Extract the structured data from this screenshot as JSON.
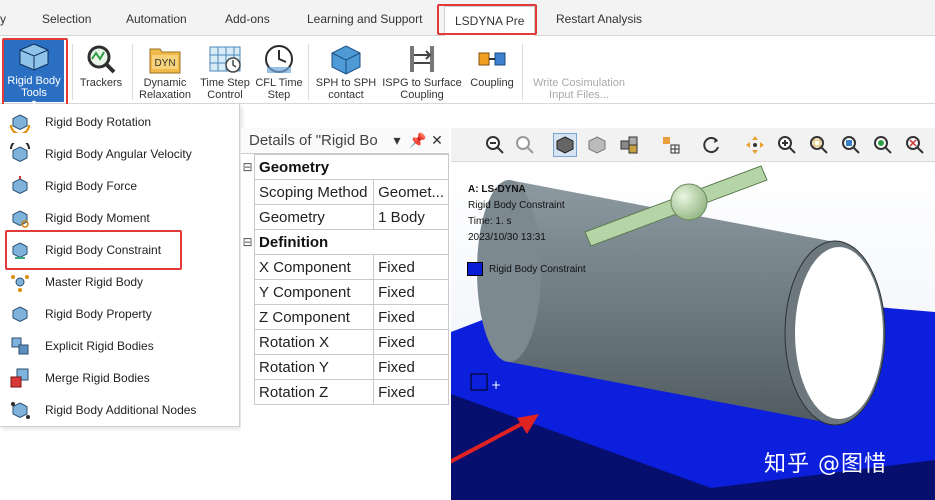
{
  "tabs": [
    {
      "label": "y"
    },
    {
      "label": "Selection"
    },
    {
      "label": "Automation"
    },
    {
      "label": "Add-ons"
    },
    {
      "label": "Learning and Support"
    },
    {
      "label": "LSDYNA Pre"
    },
    {
      "label": "Restart Analysis"
    }
  ],
  "ribbon": {
    "rigid_body_tools": "Rigid Body Tools",
    "trackers": "Trackers",
    "dynamic_relaxation": "Dynamic Relaxation",
    "dyn_icon_text": "DYN",
    "time_step_control": "Time Step Control",
    "cfl_time_step": "CFL Time Step",
    "sph_to_sph": "SPH to SPH contact",
    "ispg_to_surface": "ISPG to Surface Coupling",
    "coupling": "Coupling",
    "write_cosimulation": "Write Cosimulation Input Files..."
  },
  "menu": {
    "items": [
      {
        "label": "Rigid Body Rotation"
      },
      {
        "label": "Rigid Body Angular Velocity"
      },
      {
        "label": "Rigid Body Force"
      },
      {
        "label": "Rigid Body Moment"
      },
      {
        "label": "Rigid Body Constraint"
      },
      {
        "label": "Master Rigid Body"
      },
      {
        "label": "Rigid Body Property"
      },
      {
        "label": "Explicit Rigid Bodies"
      },
      {
        "label": "Merge Rigid Bodies"
      },
      {
        "label": "Rigid Body Additional Nodes"
      }
    ]
  },
  "details": {
    "title": "Details of \"Rigid Bo",
    "pin": "⬇",
    "close": "✕",
    "groups": [
      {
        "name": "Geometry",
        "rows": [
          {
            "key": "Scoping Method",
            "value": "Geomet..."
          },
          {
            "key": "Geometry",
            "value": "1 Body"
          }
        ]
      },
      {
        "name": "Definition",
        "rows": [
          {
            "key": "X Component",
            "value": "Fixed"
          },
          {
            "key": "Y Component",
            "value": "Fixed"
          },
          {
            "key": "Z Component",
            "value": "Fixed"
          },
          {
            "key": "Rotation X",
            "value": "Fixed"
          },
          {
            "key": "Rotation Y",
            "value": "Fixed"
          },
          {
            "key": "Rotation Z",
            "value": "Fixed"
          }
        ]
      }
    ]
  },
  "viewport": {
    "title": "A: LS-DYNA",
    "subtitle": "Rigid Body Constraint",
    "time": "Time: 1. s",
    "date": "2023/10/30 13:31",
    "legend": "Rigid Body Constraint",
    "watermark": "知乎 @图惜"
  },
  "colors": {
    "highlight": "#e03a3a",
    "accent": "#2b6fc2",
    "plate": "#0a1bd6",
    "cylinder": "#7d8c94",
    "shaft": "#b8d6a8"
  }
}
